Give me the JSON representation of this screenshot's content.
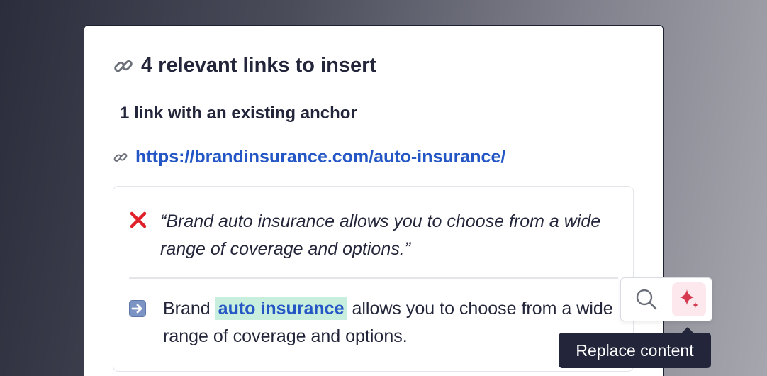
{
  "panel": {
    "title": "4 relevant links to insert",
    "subtitle": "1 link with an existing anchor",
    "url": "https://brandinsurance.com/auto-insurance/"
  },
  "suggestion": {
    "original_text": "“Brand auto insurance allows you to choose from a wide range of coverage and options.”",
    "new_prefix": "Brand",
    "anchor_text": "auto insurance",
    "new_suffix": "allows you to choose from a wide range of coverage and options."
  },
  "toolbar": {
    "tooltip": "Replace content"
  },
  "icons": {
    "title": "link-icon",
    "url": "link-icon",
    "original": "cross-mark-icon",
    "replacement": "right-arrow-icon",
    "search": "search-icon",
    "replace": "sparkle-icon"
  },
  "colors": {
    "link": "#2457c5",
    "anchor_highlight": "#c8eedd",
    "cross": "#e0202a",
    "sparkle": "#d6384f",
    "tooltip_bg": "#23263a"
  }
}
